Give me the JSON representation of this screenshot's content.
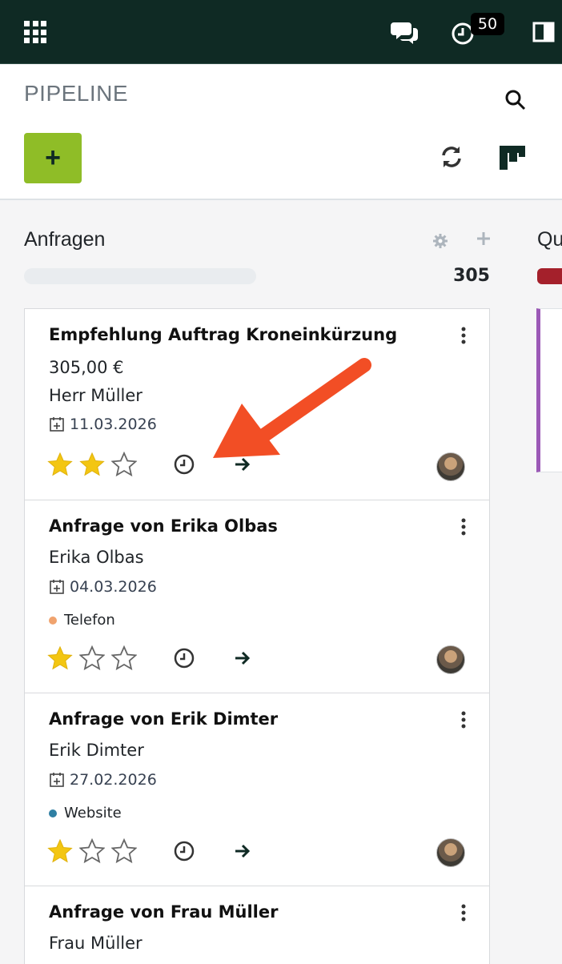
{
  "navbar": {
    "activity_count": "50"
  },
  "control_panel": {
    "title": "PIPELINE",
    "new_button_label": "+"
  },
  "columns": [
    {
      "title": "Anfragen",
      "total": "305"
    },
    {
      "title": "Qu"
    }
  ],
  "cards": [
    {
      "title": "Empfehlung Auftrag Kroneinkürzung",
      "amount": "305,00 €",
      "contact": "Herr Müller",
      "date": "11.03.2026",
      "tag": "",
      "stars": 2
    },
    {
      "title": "Anfrage von Erika Olbas",
      "contact": "Erika Olbas",
      "date": "04.03.2026",
      "tag": "Telefon",
      "tag_color": "#f0a36e",
      "stars": 1
    },
    {
      "title": "Anfrage von Erik Dimter",
      "contact": "Erik Dimter",
      "date": "27.02.2026",
      "tag": "Website",
      "tag_color": "#2f7fa3",
      "stars": 1
    },
    {
      "title": "Anfrage von Frau Müller",
      "contact": "Frau Müller"
    }
  ],
  "colors": {
    "navbar": "#0f2a24",
    "new_button": "#8fbd27",
    "star_filled": "#f3c612",
    "annotation_arrow": "#f24e25",
    "column2_bar": "#a4202b",
    "column2_card_accent": "#9b59b6"
  }
}
